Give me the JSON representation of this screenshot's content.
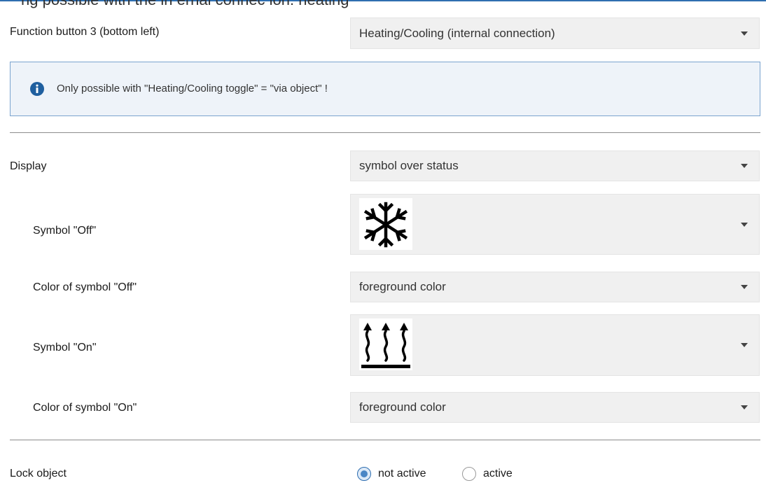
{
  "header": {
    "partial_text": "ng possible with the in ernal connec ion: heating"
  },
  "rows": {
    "function_button": {
      "label": "Function button 3 (bottom left)",
      "value": "Heating/Cooling (internal connection)"
    },
    "info": {
      "text": "Only possible with \"Heating/Cooling toggle\" = \"via object\" !"
    },
    "display": {
      "label": "Display",
      "value": "symbol over status"
    },
    "symbol_off": {
      "label": "Symbol \"Off\"",
      "icon": "snowflake-icon"
    },
    "color_off": {
      "label": "Color of symbol \"Off\"",
      "value": "foreground color"
    },
    "symbol_on": {
      "label": "Symbol \"On\"",
      "icon": "heating-icon"
    },
    "color_on": {
      "label": "Color of symbol \"On\"",
      "value": "foreground color"
    },
    "lock_object": {
      "label": "Lock object",
      "options": [
        "not active",
        "active"
      ],
      "selected": "not active"
    }
  },
  "colors": {
    "accent": "#2f6fb0",
    "info_background": "#eef3f9",
    "select_background": "#f0f0f0"
  }
}
